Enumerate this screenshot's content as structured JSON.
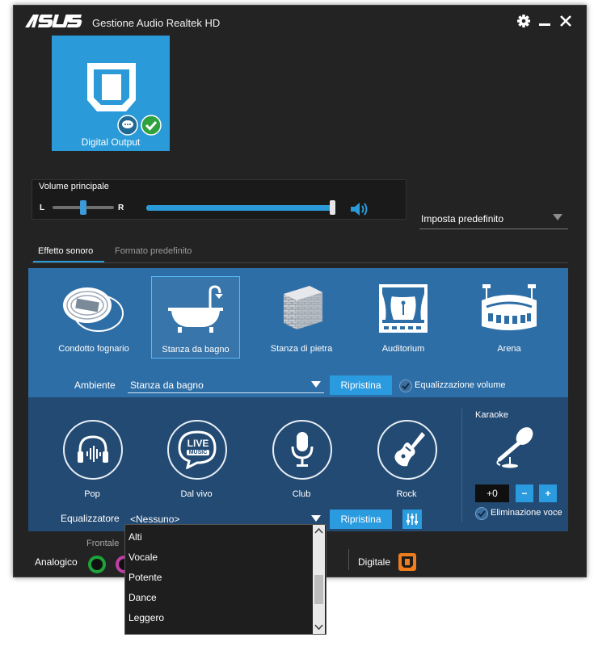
{
  "window": {
    "title": "Gestione Audio Realtek HD",
    "logo_text": "ASUS"
  },
  "device": {
    "label": "Digital Output"
  },
  "volume": {
    "title": "Volume principale",
    "left_label": "L",
    "right_label": "R",
    "balance": 0.5,
    "level": 0.99
  },
  "default_select": {
    "label": "Imposta predefinito"
  },
  "tabs": [
    {
      "label": "Effetto sonoro",
      "active": true
    },
    {
      "label": "Formato predefinito",
      "active": false
    }
  ],
  "environments": [
    {
      "label": "Condotto fognario",
      "icon": "sewer-pipe-icon"
    },
    {
      "label": "Stanza da bagno",
      "icon": "bathtub-icon",
      "selected": true
    },
    {
      "label": "Stanza di pietra",
      "icon": "stone-wall-icon"
    },
    {
      "label": "Auditorium",
      "icon": "theater-stage-icon"
    },
    {
      "label": "Arena",
      "icon": "stadium-icon"
    }
  ],
  "ambiente": {
    "label": "Ambiente",
    "value": "Stanza da bagno",
    "reset_label": "Ripristina",
    "eq_volume_label": "Equalizzazione volume"
  },
  "presets": [
    {
      "label": "Pop",
      "icon": "headphones-icon"
    },
    {
      "label": "Dal vivo",
      "icon": "live-music-icon",
      "badge_top": "LIVE",
      "badge_bottom": "MUSIC"
    },
    {
      "label": "Club",
      "icon": "microphone-icon"
    },
    {
      "label": "Rock",
      "icon": "electric-guitar-icon"
    }
  ],
  "karaoke": {
    "label": "Karaoke",
    "value": "+0",
    "minus": "−",
    "plus": "+",
    "vocal_removal_label": "Eliminazione voce"
  },
  "equalizer": {
    "label": "Equalizzatore",
    "value": "<Nessuno>",
    "reset_label": "Ripristina"
  },
  "dropdown": {
    "items": [
      "Alti",
      "Vocale",
      "Potente",
      "Dance",
      "Leggero"
    ]
  },
  "bottom": {
    "analog_label": "Analogico",
    "front_label": "Frontale",
    "digital_label": "Digitale"
  },
  "colors": {
    "accent": "#2a9ad8",
    "panel_top": "#2e6ea6",
    "panel_bottom": "#234a73",
    "digital_orange": "#f07d1c"
  }
}
